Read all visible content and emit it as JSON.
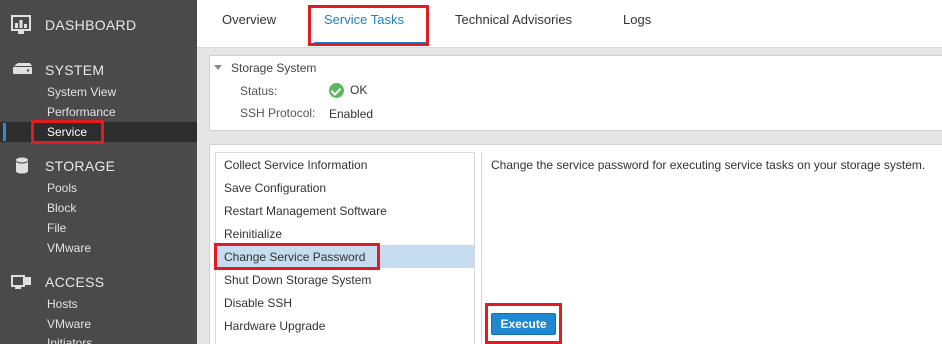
{
  "sidebar": {
    "dashboard": {
      "label": "DASHBOARD",
      "icon": "dashboard-icon"
    },
    "system": {
      "label": "SYSTEM",
      "icon": "server-icon",
      "items": [
        {
          "label": "System View"
        },
        {
          "label": "Performance"
        },
        {
          "label": "Service",
          "active": true
        }
      ]
    },
    "storage": {
      "label": "STORAGE",
      "icon": "database-icon",
      "items": [
        {
          "label": "Pools"
        },
        {
          "label": "Block"
        },
        {
          "label": "File"
        },
        {
          "label": "VMware"
        }
      ]
    },
    "access": {
      "label": "ACCESS",
      "icon": "access-icon",
      "items": [
        {
          "label": "Hosts"
        },
        {
          "label": "VMware"
        },
        {
          "label": "Initiators"
        }
      ]
    }
  },
  "tabs": [
    {
      "label": "Overview"
    },
    {
      "label": "Service Tasks",
      "active": true
    },
    {
      "label": "Technical Advisories"
    },
    {
      "label": "Logs"
    }
  ],
  "storage_system": {
    "title": "Storage System",
    "status_label": "Status:",
    "status_value": "OK",
    "ssh_label": "SSH Protocol:",
    "ssh_value": "Enabled"
  },
  "tasks": [
    {
      "label": "Collect Service Information"
    },
    {
      "label": "Save Configuration"
    },
    {
      "label": "Restart Management Software"
    },
    {
      "label": "Reinitialize"
    },
    {
      "label": "Change Service Password",
      "selected": true
    },
    {
      "label": "Shut Down Storage System"
    },
    {
      "label": "Disable SSH"
    },
    {
      "label": "Hardware Upgrade"
    }
  ],
  "task_description": "Change the service password for executing service tasks on your storage system.",
  "execute_label": "Execute",
  "colors": {
    "sidebar_bg": "#4a4a4a",
    "accent": "#1f7fc6",
    "selected_row": "#c6dcf0",
    "highlight_box": "#e11b22",
    "status_ok": "#5cb85c"
  }
}
